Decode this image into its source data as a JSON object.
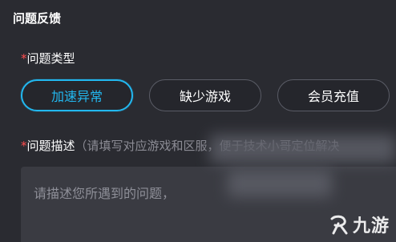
{
  "page": {
    "title": "问题反馈"
  },
  "problem_type": {
    "required_mark": "*",
    "label": "问题类型",
    "options": [
      {
        "label": "加速异常",
        "selected": true
      },
      {
        "label": "缺少游戏",
        "selected": false
      },
      {
        "label": "会员充值",
        "selected": false
      }
    ]
  },
  "description": {
    "required_mark": "*",
    "label": "问题描述",
    "hint": "（请填写对应游戏和区服，便于技术小哥定位解决",
    "placeholder": "请描述您所遇到的问题，"
  },
  "watermark": {
    "text": "九游"
  },
  "colors": {
    "accent": "#22b8f0",
    "required": "#ff4d4f",
    "background": "#2a2b31"
  }
}
